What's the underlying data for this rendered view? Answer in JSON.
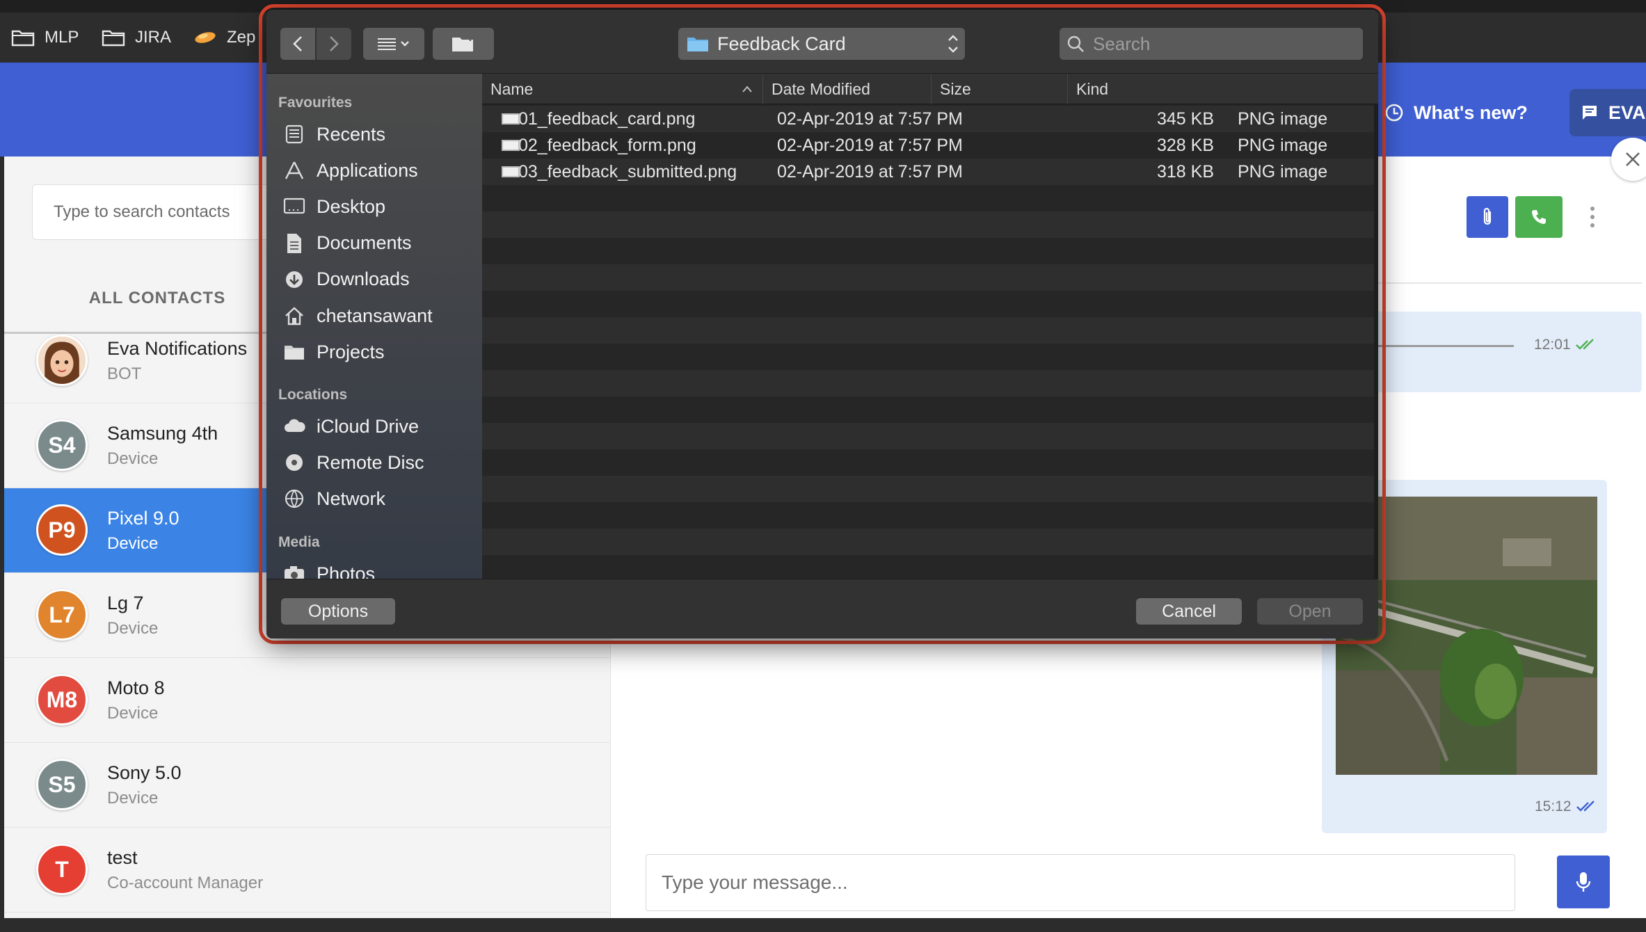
{
  "bookmarks": [
    {
      "label": "MLP",
      "icon": "folder-icon"
    },
    {
      "label": "JIRA",
      "icon": "folder-icon"
    },
    {
      "label": "Zep",
      "icon": "zeplin-icon"
    }
  ],
  "app": {
    "whats_new": "What's new?",
    "eva_label": "EVA",
    "search_placeholder": "Type to search contacts",
    "tab_all_contacts": "ALL CONTACTS",
    "contacts": [
      {
        "name": "Eva Notifications",
        "sub": "BOT",
        "avatar": "",
        "color": "#e9c9b4",
        "selected": false
      },
      {
        "name": "Samsung 4th",
        "sub": "Device",
        "avatar": "S4",
        "color": "#7b8a8b",
        "selected": false
      },
      {
        "name": "Pixel 9.0",
        "sub": "Device",
        "avatar": "P9",
        "color": "#d0521e",
        "selected": true
      },
      {
        "name": "Lg 7",
        "sub": "Device",
        "avatar": "L7",
        "color": "#e0842e",
        "selected": false
      },
      {
        "name": "Moto 8",
        "sub": "Device",
        "avatar": "M8",
        "color": "#e24b3f",
        "selected": false
      },
      {
        "name": "Sony 5.0",
        "sub": "Device",
        "avatar": "S5",
        "color": "#7b8a8b",
        "selected": false
      },
      {
        "name": "test",
        "sub": "Co-account Manager",
        "avatar": "T",
        "color": "#e53e33",
        "selected": false
      }
    ],
    "chat": {
      "time1": "12:01",
      "time2": "15:12",
      "message_placeholder": "Type your message..."
    },
    "colors": {
      "header": "#3f5fd3",
      "call": "#4cb050",
      "selected": "#3b84e6"
    }
  },
  "dialog": {
    "location": "Feedback Card",
    "search_placeholder": "Search",
    "sidebar": {
      "favourites_label": "Favourites",
      "favourites": [
        {
          "label": "Recents",
          "icon": "recents-icon"
        },
        {
          "label": "Applications",
          "icon": "applications-icon"
        },
        {
          "label": "Desktop",
          "icon": "desktop-icon"
        },
        {
          "label": "Documents",
          "icon": "documents-icon"
        },
        {
          "label": "Downloads",
          "icon": "downloads-icon"
        },
        {
          "label": "chetansawant",
          "icon": "home-icon"
        },
        {
          "label": "Projects",
          "icon": "folder-icon"
        }
      ],
      "locations_label": "Locations",
      "locations": [
        {
          "label": "iCloud Drive",
          "icon": "cloud-icon"
        },
        {
          "label": "Remote Disc",
          "icon": "disc-icon"
        },
        {
          "label": "Network",
          "icon": "network-icon"
        }
      ],
      "media_label": "Media",
      "media": [
        {
          "label": "Photos",
          "icon": "camera-icon"
        }
      ]
    },
    "columns": {
      "name": "Name",
      "date": "Date Modified",
      "size": "Size",
      "kind": "Kind"
    },
    "files": [
      {
        "name": "01_feedback_card.png",
        "date": "02-Apr-2019 at 7:57 PM",
        "size": "345 KB",
        "kind": "PNG image"
      },
      {
        "name": "02_feedback_form.png",
        "date": "02-Apr-2019 at 7:57 PM",
        "size": "328 KB",
        "kind": "PNG image"
      },
      {
        "name": "03_feedback_submitted.png",
        "date": "02-Apr-2019 at 7:57 PM",
        "size": "318 KB",
        "kind": "PNG image"
      }
    ],
    "buttons": {
      "options": "Options",
      "cancel": "Cancel",
      "open": "Open"
    },
    "highlight_color": "#e0452f"
  }
}
